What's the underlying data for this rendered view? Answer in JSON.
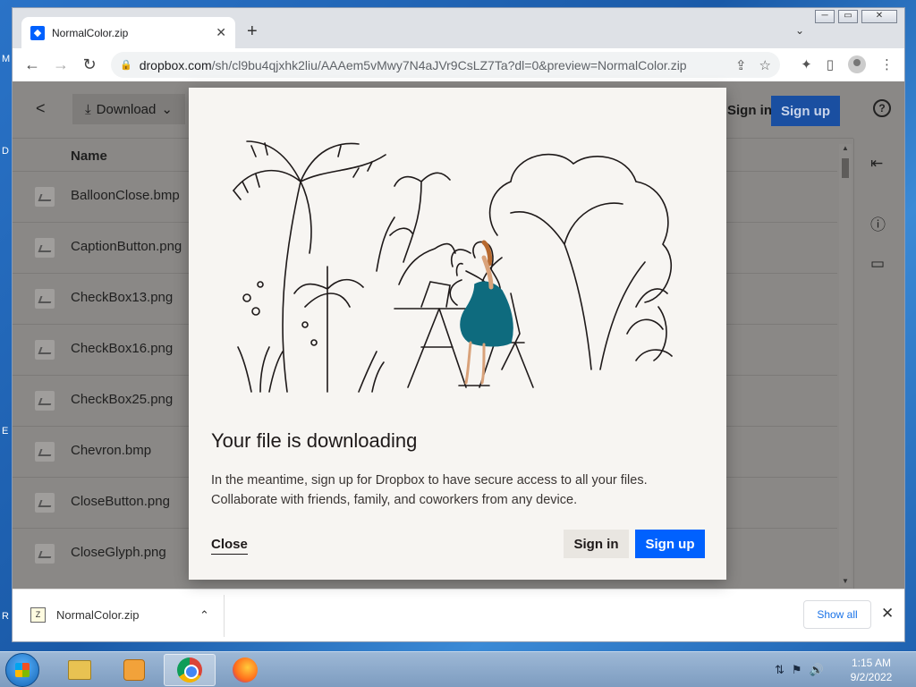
{
  "desktop": {
    "letters": [
      "M",
      "D",
      "E",
      "R"
    ]
  },
  "window": {
    "controls": [
      "─",
      "▭",
      "✕"
    ]
  },
  "tab": {
    "title": "NormalColor.zip",
    "close": "✕"
  },
  "newtab": "+",
  "tabsearch": "⌄",
  "toolbar": {
    "back": "←",
    "forward": "→",
    "reload": "↻",
    "url_host": "dropbox.com",
    "url_path": "/sh/cl9bu4qjxhk2liu/AAAem5vMwy7N4aJVr9CsLZ7Ta?dl=0&preview=NormalColor.zip",
    "share": "⇪",
    "star": "☆",
    "extensions": "✦",
    "sidepanel": "▯",
    "menu": "⋮"
  },
  "page": {
    "back": "<",
    "download_label": "Download",
    "download_icon": "⤓",
    "download_caret": "⌄",
    "signin_label": "Sign in",
    "signup_label": "Sign up",
    "help": "?",
    "column_name": "Name",
    "files": [
      {
        "name": "BalloonClose.bmp"
      },
      {
        "name": "CaptionButton.png"
      },
      {
        "name": "CheckBox13.png"
      },
      {
        "name": "CheckBox16.png"
      },
      {
        "name": "CheckBox25.png"
      },
      {
        "name": "Chevron.bmp"
      },
      {
        "name": "CloseButton.png"
      },
      {
        "name": "CloseGlyph.png"
      }
    ],
    "rail": {
      "collapse": "⇤",
      "info": "ⓘ",
      "comment": "▭"
    },
    "scroll_up": "▲",
    "scroll_down": "▼"
  },
  "modal": {
    "title": "Your file is downloading",
    "body": "In the meantime, sign up for Dropbox to have secure access to all your files. Collaborate with friends, family, and coworkers from any device.",
    "close_label": "Close",
    "signin_label": "Sign in",
    "signup_label": "Sign up",
    "accent": "#0061fe"
  },
  "download_bar": {
    "filename": "NormalColor.zip",
    "chevron": "⌃",
    "show_all": "Show all",
    "close": "✕"
  },
  "taskbar": {
    "time": "1:15 AM",
    "date": "9/2/2022",
    "tray_icons": [
      "⇅",
      "⚑",
      "🔊"
    ]
  }
}
